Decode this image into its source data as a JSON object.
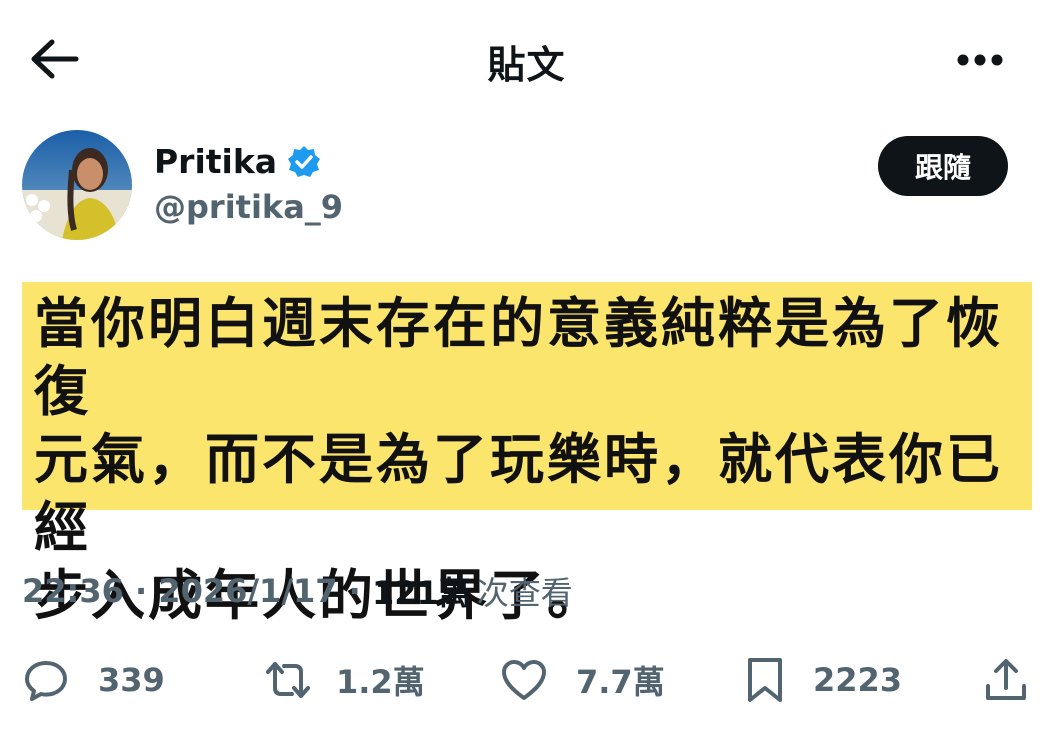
{
  "header": {
    "title": "貼文"
  },
  "author": {
    "display_name": "Pritika",
    "handle": "@pritika_9",
    "follow_label": "跟隨"
  },
  "post": {
    "image_text_lines": [
      "當你明白週末存在的意義純粹是為了恢復",
      "元氣，而不是為了玩樂時，就代表你已經",
      "步入成年人的世界了。"
    ],
    "background_color": "#fbe56d"
  },
  "meta": {
    "time": "22:36",
    "date": "2026/1/17",
    "views": "121萬",
    "views_label": "次查看"
  },
  "actions": {
    "replies": "339",
    "reposts": "1.2萬",
    "likes": "7.7萬",
    "bookmarks": "2223"
  },
  "colors": {
    "verified": "#1d9bf0",
    "text": "#0f1419",
    "muted": "#536471"
  },
  "icons": [
    "back-arrow-icon",
    "more-icon",
    "verified-badge-icon",
    "reply-icon",
    "repost-icon",
    "like-icon",
    "bookmark-icon",
    "share-icon"
  ]
}
